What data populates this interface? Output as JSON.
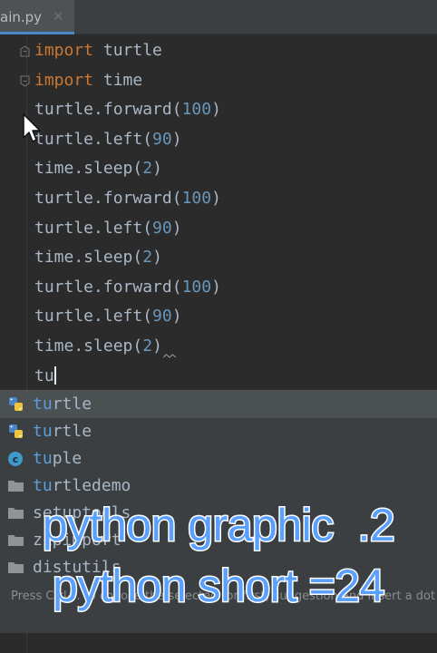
{
  "tab": {
    "label": "ain.py",
    "close_glyph": "✕"
  },
  "code_lines": [
    {
      "kw": "import",
      "rest": " turtle",
      "fold": true
    },
    {
      "kw": "import",
      "rest": " time",
      "fold": true
    },
    {
      "pre": "turtle.forward(",
      "num": "100",
      "post": ")"
    },
    {
      "pre": "turtle.left(",
      "num": "90",
      "post": ")"
    },
    {
      "pre": "time.sleep(",
      "num": "2",
      "post": ")"
    },
    {
      "pre": "turtle.forward(",
      "num": "100",
      "post": ")"
    },
    {
      "pre": "turtle.left(",
      "num": "90",
      "post": ")"
    },
    {
      "pre": "time.sleep(",
      "num": "2",
      "post": ")"
    },
    {
      "pre": "turtle.forward(",
      "num": "100",
      "post": ")"
    },
    {
      "pre": "turtle.left(",
      "num": "90",
      "post": ")"
    },
    {
      "pre": "time.sleep(",
      "num": "2",
      "post": ")"
    },
    {
      "pre": "tu",
      "caret": true
    }
  ],
  "completion": {
    "items": [
      {
        "match": "tu",
        "rest": "rtle",
        "icon": "python-package-icon",
        "selected": true
      },
      {
        "match": "tu",
        "rest": "rtle",
        "icon": "python-package-icon"
      },
      {
        "match": "tu",
        "rest": "ple",
        "icon": "class-icon"
      },
      {
        "match": "tu",
        "rest": "rtledemo",
        "icon": "folder-icon"
      },
      {
        "match": "",
        "rest": "setuptools",
        "icon": "folder-icon"
      },
      {
        "match": "",
        "rest": "zipimport",
        "icon": "folder-icon"
      },
      {
        "match": "",
        "rest": "distutils",
        "icon": "folder-icon"
      }
    ],
    "hint": "Press Ctrl+. to choose the selected (or first) suggestion and insert a dot afterwards"
  },
  "caption": {
    "line1": "python graphic  .2",
    "line2": "python short =24"
  },
  "colors": {
    "background": "#2b2b2b",
    "keyword": "#cc7832",
    "number": "#6897bb",
    "text": "#a9b7c6",
    "popup_bg": "#3c3f41",
    "match": "#5c9ddb",
    "caption_fill": "#5aa0ff"
  }
}
